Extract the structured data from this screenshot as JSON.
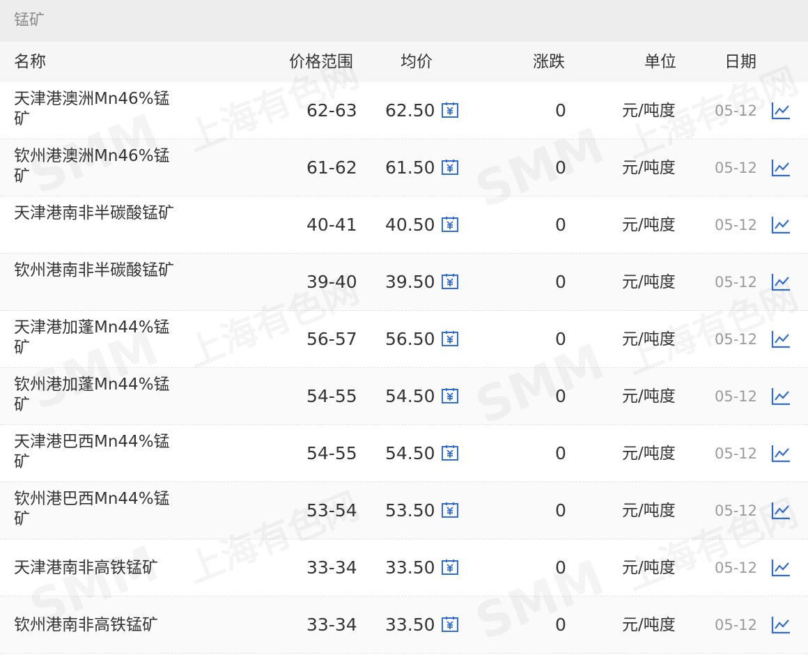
{
  "section": {
    "title": "锰矿"
  },
  "columns": {
    "name": "名称",
    "range": "价格范围",
    "avg": "均价",
    "change": "涨跌",
    "unit": "单位",
    "date": "日期"
  },
  "rows": [
    {
      "name": "天津港澳洲Mn46%锰矿",
      "range": "62-63",
      "avg": "62.50",
      "change": "0",
      "unit": "元/吨度",
      "date": "05-12"
    },
    {
      "name": "钦州港澳洲Mn46%锰矿",
      "range": "61-62",
      "avg": "61.50",
      "change": "0",
      "unit": "元/吨度",
      "date": "05-12"
    },
    {
      "name": "天津港南非半碳酸锰矿",
      "range": "40-41",
      "avg": "40.50",
      "change": "0",
      "unit": "元/吨度",
      "date": "05-12"
    },
    {
      "name": "钦州港南非半碳酸锰矿",
      "range": "39-40",
      "avg": "39.50",
      "change": "0",
      "unit": "元/吨度",
      "date": "05-12"
    },
    {
      "name": "天津港加蓬Mn44%锰矿",
      "range": "56-57",
      "avg": "56.50",
      "change": "0",
      "unit": "元/吨度",
      "date": "05-12"
    },
    {
      "name": "钦州港加蓬Mn44%锰矿",
      "range": "54-55",
      "avg": "54.50",
      "change": "0",
      "unit": "元/吨度",
      "date": "05-12"
    },
    {
      "name": "天津港巴西Mn44%锰矿",
      "range": "54-55",
      "avg": "54.50",
      "change": "0",
      "unit": "元/吨度",
      "date": "05-12"
    },
    {
      "name": "钦州港巴西Mn44%锰矿",
      "range": "53-54",
      "avg": "53.50",
      "change": "0",
      "unit": "元/吨度",
      "date": "05-12"
    },
    {
      "name": "天津港南非高铁锰矿",
      "range": "33-34",
      "avg": "33.50",
      "change": "0",
      "unit": "元/吨度",
      "date": "05-12"
    },
    {
      "name": "钦州港南非高铁锰矿",
      "range": "33-34",
      "avg": "33.50",
      "change": "0",
      "unit": "元/吨度",
      "date": "05-12"
    }
  ],
  "watermark": {
    "brand": "SMM",
    "text": "上海有色网"
  },
  "icons": {
    "avg_calendar": "calendar-price-icon",
    "trend": "trend-chart-icon"
  },
  "colors": {
    "icon_blue": "#2f6bd6",
    "date_gray": "#9a9a9a",
    "title_bg": "#ededed"
  }
}
